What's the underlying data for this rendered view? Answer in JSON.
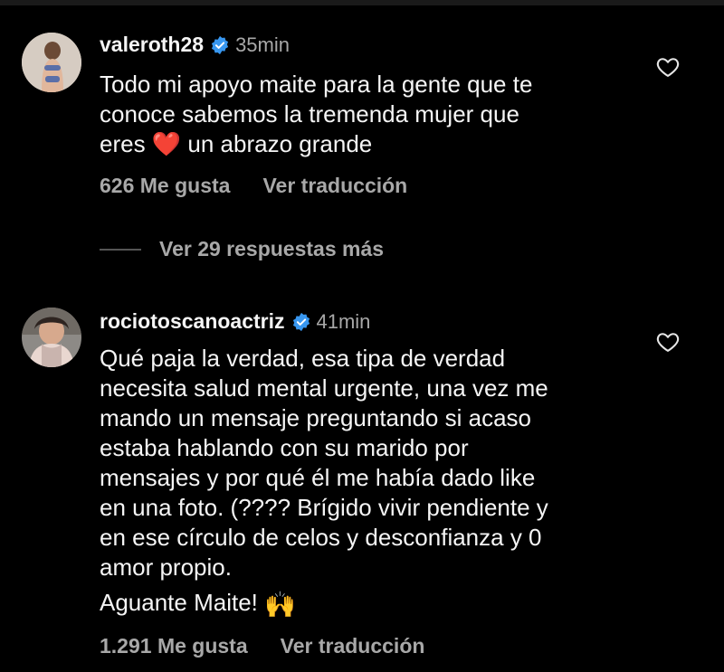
{
  "comments": [
    {
      "username": "valeroth28",
      "time": "35min",
      "text_before_emoji": "Todo mi apoyo maite para la gente que te\nconoce sabemos la tremenda mujer que\neres ",
      "emoji": "❤️",
      "text_after_emoji": " un abrazo grande",
      "likes": "626 Me gusta",
      "translate": "Ver traducción"
    },
    {
      "username": "rociotoscanoactriz",
      "time": "41min",
      "text": "Qué paja la verdad, esa tipa de verdad\nnecesita salud mental urgente, una vez me\nmando un mensaje preguntando si acaso\nestaba hablando con su marido por\nmensajes y por qué él me había dado like\nen una foto. (???? Brígido vivir pendiente y\nen ese círculo de celos y desconfianza y 0\namor propio.",
      "text_line2": "Aguante Maite! ",
      "emoji": "🙌",
      "likes": "1.291 Me gusta",
      "translate": "Ver traducción"
    }
  ],
  "replies_label": "Ver 29 respuestas más",
  "icons": {
    "verified": "verified-badge-icon",
    "like": "heart-outline-icon",
    "accent": "#3897f0"
  }
}
